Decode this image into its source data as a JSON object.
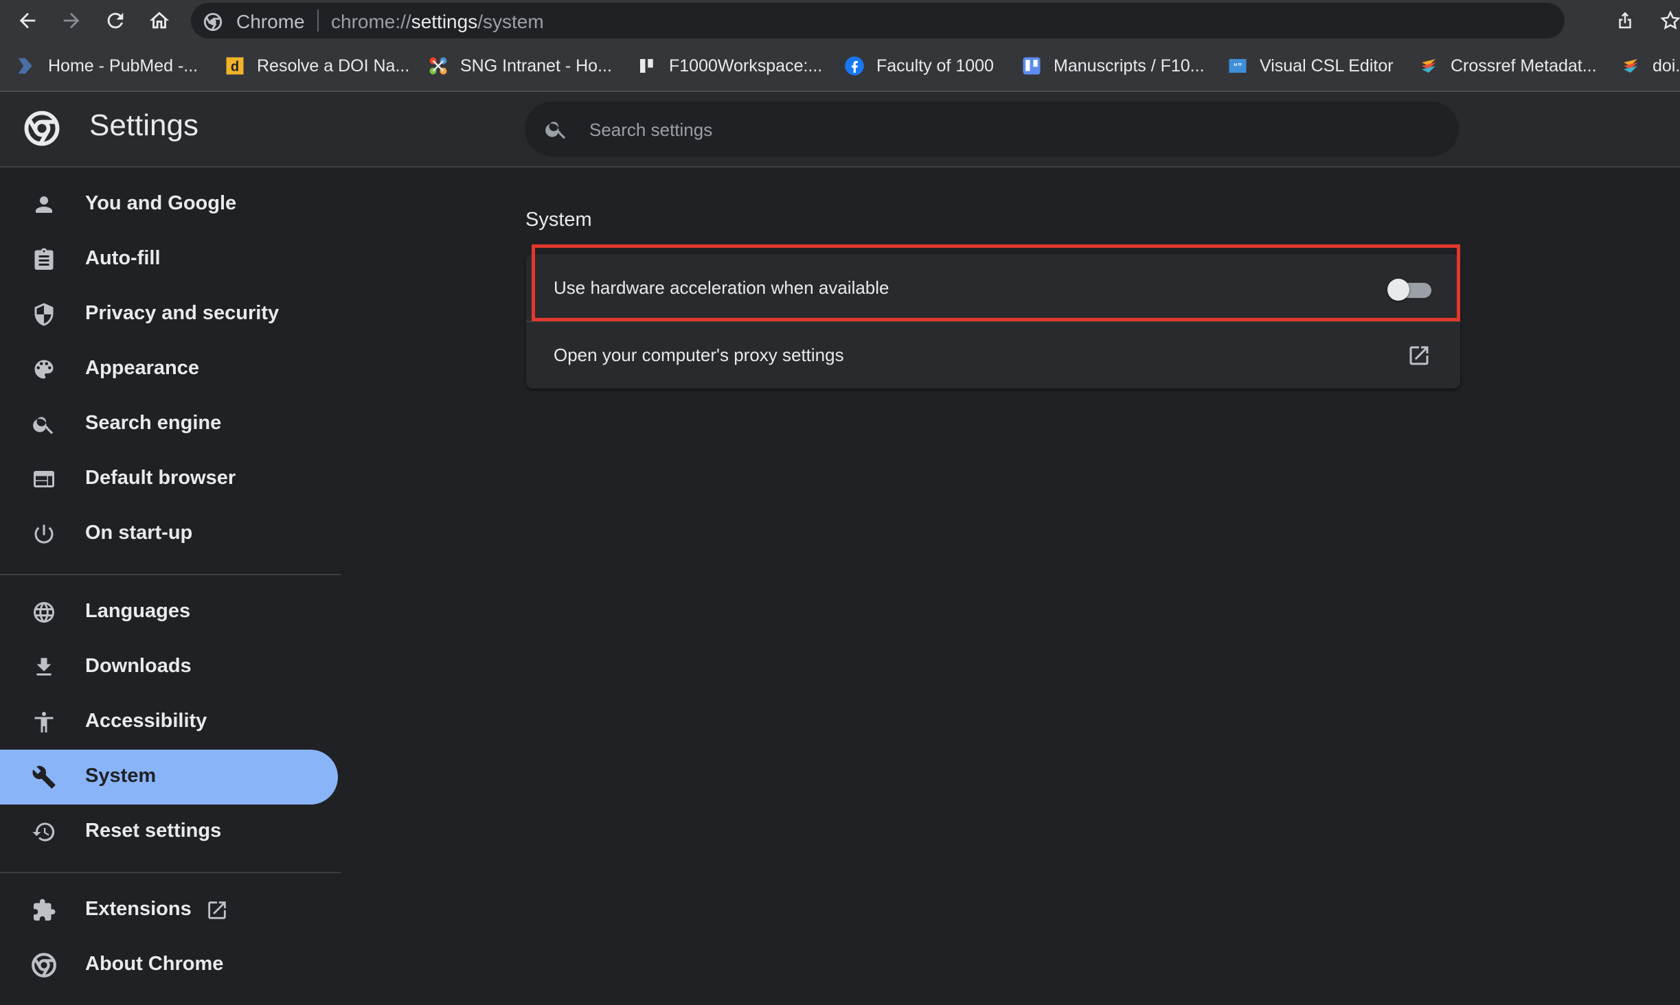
{
  "toolbar": {
    "back_icon": "back-arrow-icon",
    "forward_icon": "forward-arrow-icon",
    "reload_icon": "reload-icon",
    "home_icon": "home-icon",
    "omnibox": {
      "chip_label": "Chrome",
      "url_scheme": "chrome://",
      "url_host": "settings",
      "url_path": "/system"
    }
  },
  "bookmarks": [
    {
      "label": "Home - PubMed -...",
      "icon": "pubmed-icon"
    },
    {
      "label": "Resolve a DOI Na...",
      "icon": "doi-icon"
    },
    {
      "label": "SNG Intranet - Ho...",
      "icon": "joomla-icon"
    },
    {
      "label": "F1000Workspace:...",
      "icon": "workspace-icon"
    },
    {
      "label": "Faculty of 1000",
      "icon": "facebook-icon"
    },
    {
      "label": "Manuscripts / F10...",
      "icon": "trello-icon"
    },
    {
      "label": "Visual CSL Editor",
      "icon": "csl-icon"
    },
    {
      "label": "Crossref Metadat...",
      "icon": "crossref-icon"
    },
    {
      "label": "doi.",
      "icon": "crossref-icon"
    }
  ],
  "header": {
    "title": "Settings",
    "search_placeholder": "Search settings"
  },
  "sidebar": {
    "items": [
      {
        "label": "You and Google",
        "icon": "person-icon"
      },
      {
        "label": "Auto-fill",
        "icon": "clipboard-icon"
      },
      {
        "label": "Privacy and security",
        "icon": "shield-icon"
      },
      {
        "label": "Appearance",
        "icon": "palette-icon"
      },
      {
        "label": "Search engine",
        "icon": "search-icon"
      },
      {
        "label": "Default browser",
        "icon": "browser-window-icon"
      },
      {
        "label": "On start-up",
        "icon": "power-icon"
      },
      {
        "label": "Languages",
        "icon": "globe-icon"
      },
      {
        "label": "Downloads",
        "icon": "download-icon"
      },
      {
        "label": "Accessibility",
        "icon": "accessibility-icon"
      },
      {
        "label": "System",
        "icon": "wrench-icon",
        "active": true
      },
      {
        "label": "Reset settings",
        "icon": "history-icon"
      },
      {
        "label": "Extensions",
        "icon": "puzzle-icon"
      },
      {
        "label": "About Chrome",
        "icon": "chrome-logo-icon"
      }
    ]
  },
  "main": {
    "section_title": "System",
    "rows": [
      {
        "label": "Use hardware acceleration when available",
        "control": "toggle",
        "enabled": false
      },
      {
        "label": "Open your computer's proxy settings",
        "control": "external-link"
      }
    ]
  },
  "colors": {
    "background": "#202124",
    "toolbar": "#35363a",
    "card": "#292a2d",
    "accent": "#8ab4f8",
    "highlight": "#e2382c"
  }
}
